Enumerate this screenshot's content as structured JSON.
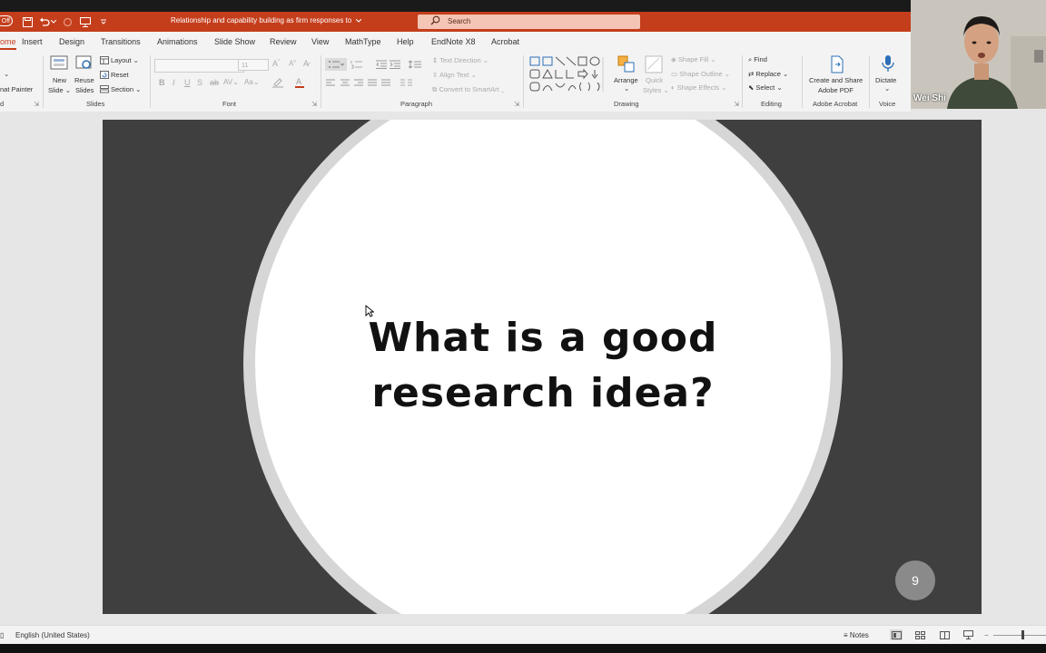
{
  "titlebar": {
    "autosave_label": "Off",
    "doc_title": "Relationship and capability building as firm responses to",
    "search_placeholder": "Search"
  },
  "tabs": [
    {
      "label": "ome",
      "active": true
    },
    {
      "label": "Insert"
    },
    {
      "label": "Design"
    },
    {
      "label": "Transitions"
    },
    {
      "label": "Animations"
    },
    {
      "label": "Slide Show"
    },
    {
      "label": "Review"
    },
    {
      "label": "View"
    },
    {
      "label": "MathType"
    },
    {
      "label": "Help"
    },
    {
      "label": "EndNote X8"
    },
    {
      "label": "Acrobat"
    }
  ],
  "ribbon": {
    "clipboard": {
      "format_painter": "nat Painter",
      "group": "d"
    },
    "slides": {
      "new_slide_1": "New",
      "new_slide_2": "Slide",
      "reuse_1": "Reuse",
      "reuse_2": "Slides",
      "layout": "Layout",
      "reset": "Reset",
      "section": "Section",
      "group": "Slides"
    },
    "font": {
      "group": "Font"
    },
    "paragraph": {
      "text_direction": "Text Direction",
      "align_text": "Align Text",
      "smartart": "Convert to SmartArt",
      "group": "Paragraph"
    },
    "drawing": {
      "arrange": "Arrange",
      "quick_1": "Quick",
      "quick_2": "Styles",
      "shape_fill": "Shape Fill",
      "shape_outline": "Shape Outline",
      "shape_effects": "Shape Effects",
      "group": "Drawing"
    },
    "editing": {
      "find": "Find",
      "replace": "Replace",
      "select": "Select",
      "group": "Editing"
    },
    "acrobat": {
      "create_1": "Create and Share",
      "create_2": "Adobe PDF",
      "group": "Adobe Acrobat"
    },
    "voice": {
      "dictate": "Dictate",
      "group": "Voice"
    }
  },
  "video": {
    "participant_name": "Wei Shi"
  },
  "slide": {
    "title": "What is a good research idea?",
    "page_number": "9"
  },
  "statusbar": {
    "language": "English (United States)",
    "notes": "Notes"
  },
  "colors": {
    "accent": "#c43e1c",
    "slide_bg": "#3f3f3f"
  }
}
